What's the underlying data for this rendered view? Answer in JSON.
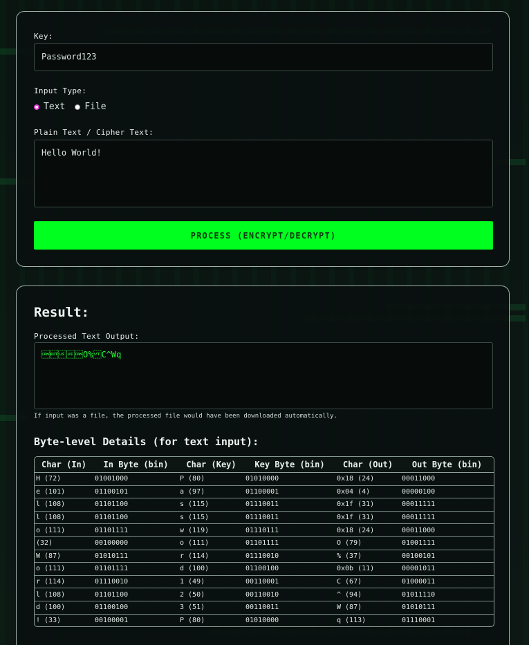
{
  "form": {
    "key_label": "Key:",
    "key_value": "Password123",
    "input_type_label": "Input Type:",
    "input_type_options": [
      "Text",
      "File"
    ],
    "input_type_selected": "Text",
    "text_label": "Plain Text / Cipher Text:",
    "text_value": "Hello World!",
    "process_button": "PROCESS (ENCRYPT/DECRYPT)"
  },
  "result": {
    "title": "Result:",
    "output_label": "Processed Text Output:",
    "output_value": "\u0018\u0004\u001f\u001f\u0018O%\u000bC^Wq",
    "file_hint": "If input was a file, the processed file would have been downloaded automatically.",
    "details_title": "Byte-level Details (for text input):",
    "columns": [
      "Char (In)",
      "In Byte (bin)",
      "Char (Key)",
      "Key Byte (bin)",
      "Char (Out)",
      "Out Byte (bin)"
    ],
    "rows": [
      [
        "H (72)",
        "01001000",
        "P (80)",
        "01010000",
        "0x18 (24)",
        "00011000"
      ],
      [
        "e (101)",
        "01100101",
        "a (97)",
        "01100001",
        "0x04 (4)",
        "00000100"
      ],
      [
        "l (108)",
        "01101100",
        "s (115)",
        "01110011",
        "0x1f (31)",
        "00011111"
      ],
      [
        "l (108)",
        "01101100",
        "s (115)",
        "01110011",
        "0x1f (31)",
        "00011111"
      ],
      [
        "o (111)",
        "01101111",
        "w (119)",
        "01110111",
        "0x18 (24)",
        "00011000"
      ],
      [
        " (32)",
        "00100000",
        "o (111)",
        "01101111",
        "O (79)",
        "01001111"
      ],
      [
        "W (87)",
        "01010111",
        "r (114)",
        "01110010",
        "% (37)",
        "00100101"
      ],
      [
        "o (111)",
        "01101111",
        "d (100)",
        "01100100",
        "0x0b (11)",
        "00001011"
      ],
      [
        "r (114)",
        "01110010",
        "1 (49)",
        "00110001",
        "C (67)",
        "01000011"
      ],
      [
        "l (108)",
        "01101100",
        "2 (50)",
        "00110010",
        "^ (94)",
        "01011110"
      ],
      [
        "d (100)",
        "01100100",
        "3 (51)",
        "00110011",
        "W (87)",
        "01010111"
      ],
      [
        "! (33)",
        "00100001",
        "P (80)",
        "01010000",
        "q (113)",
        "01110001"
      ]
    ]
  }
}
